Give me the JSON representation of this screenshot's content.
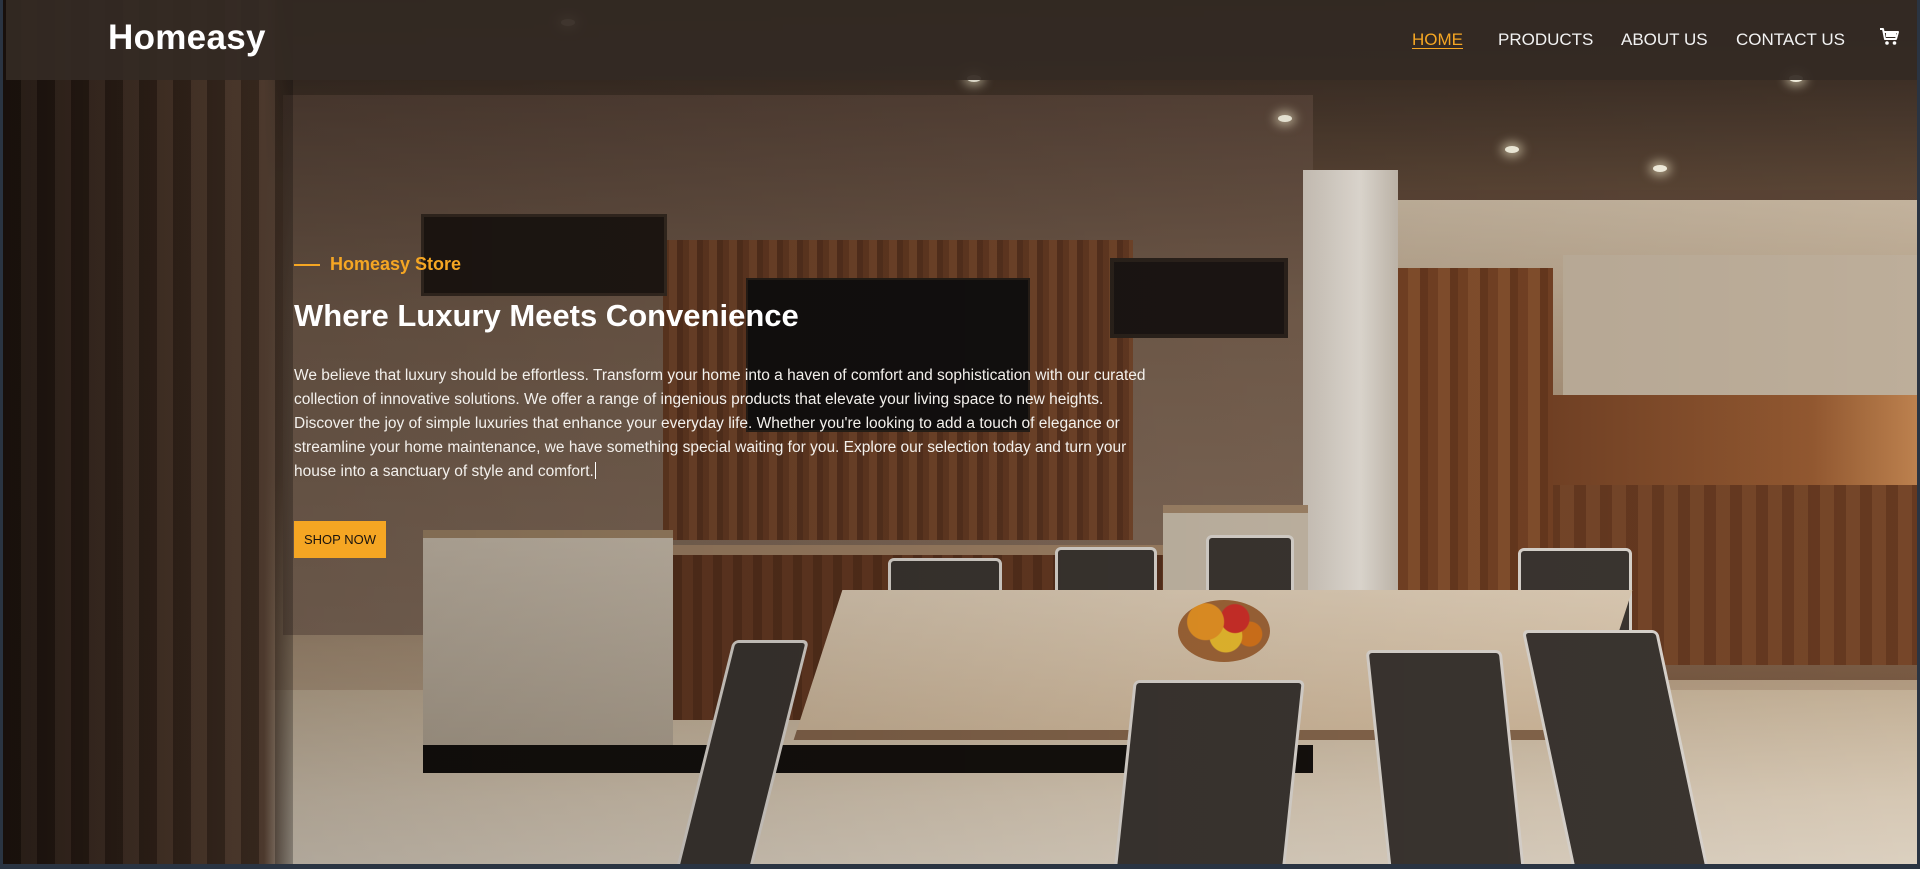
{
  "brand": {
    "name": "Homeasy"
  },
  "nav": {
    "items": [
      {
        "label": "HOME",
        "active": true
      },
      {
        "label": "PRODUCTS",
        "active": false
      },
      {
        "label": "ABOUT US",
        "active": false
      },
      {
        "label": "CONTACT US",
        "active": false
      }
    ],
    "cart_icon": "cart-icon"
  },
  "hero": {
    "tagline": "Homeasy Store",
    "headline": "Where Luxury Meets Convenience",
    "description": "We believe that luxury should be effortless. Transform your home into a haven of comfort and sophistication with our curated collection of innovative solutions. We offer a range of ingenious products that elevate your living space to new heights. Discover the joy of simple luxuries that enhance your everyday life. Whether you're looking to add a touch of elegance or streamline your home maintenance, we have something special waiting for you. Explore our selection today and turn your house into a sanctuary of style and comfort.",
    "cta_label": "SHOP NOW"
  },
  "colors": {
    "accent": "#f5a623",
    "header_bg": "#342a23",
    "text_light": "#ffffff"
  }
}
